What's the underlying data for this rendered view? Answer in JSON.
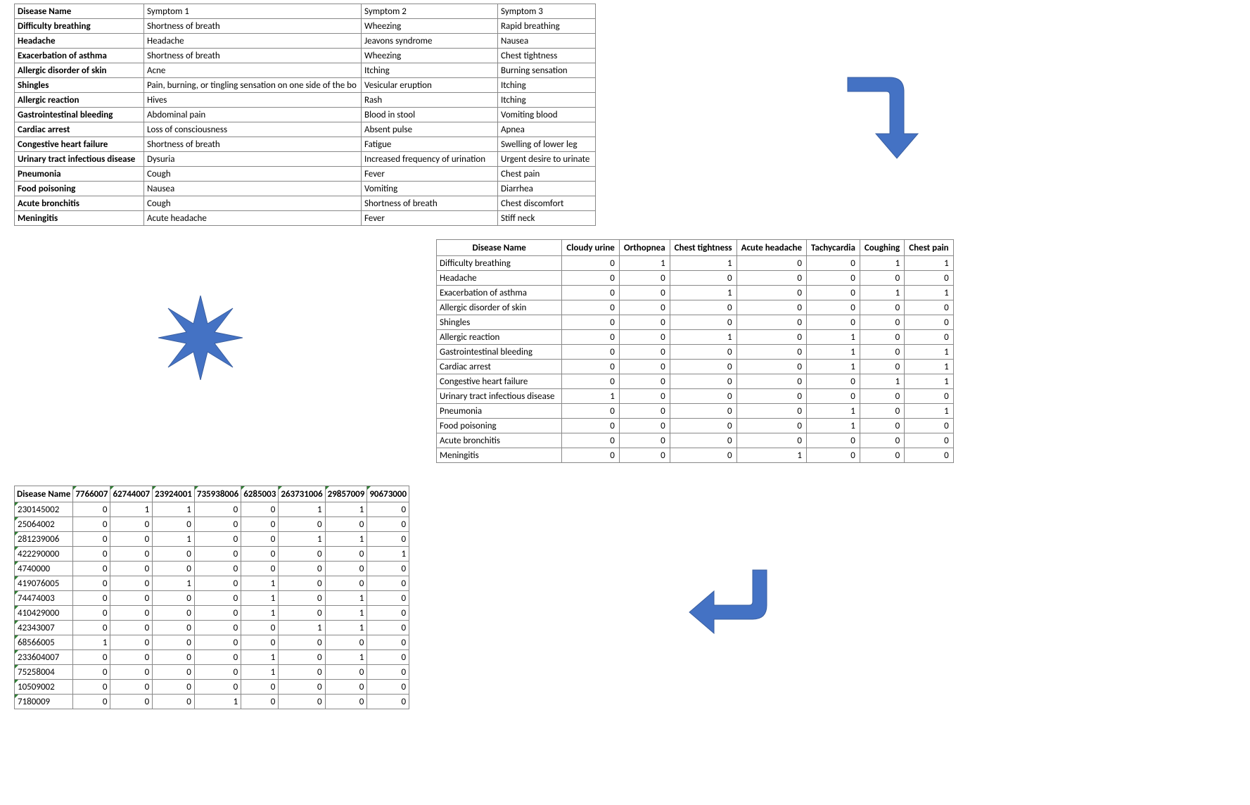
{
  "table1": {
    "headers": [
      "Disease Name",
      "Symptom 1",
      "Symptom 2",
      "Symptom 3"
    ],
    "rows": [
      [
        "Difficulty breathing",
        "Shortness of breath",
        "Wheezing",
        "Rapid breathing"
      ],
      [
        "Headache",
        "Headache",
        " Jeavons syndrome",
        "Nausea"
      ],
      [
        "Exacerbation of asthma",
        "Shortness of breath",
        "Wheezing",
        "Chest tightness"
      ],
      [
        "Allergic disorder of skin",
        "Acne",
        "Itching",
        "Burning sensation"
      ],
      [
        "Shingles",
        "Pain, burning, or tingling sensation on one side of the bo",
        "Vesicular eruption",
        "Itching"
      ],
      [
        "Allergic reaction",
        "Hives",
        "Rash",
        "Itching"
      ],
      [
        "Gastrointestinal bleeding",
        "Abdominal pain",
        "Blood in stool",
        "Vomiting blood"
      ],
      [
        "Cardiac arrest",
        "Loss of consciousness",
        " Absent pulse",
        "Apnea"
      ],
      [
        "Congestive heart failure",
        "Shortness of breath",
        "Fatigue",
        "Swelling of lower leg"
      ],
      [
        "Urinary tract infectious disease",
        "Dysuria",
        " Increased frequency of urination",
        "Urgent desire to urinate"
      ],
      [
        "Pneumonia",
        "Cough",
        "Fever",
        "Chest pain"
      ],
      [
        "Food poisoning",
        "Nausea",
        "Vomiting",
        "Diarrhea"
      ],
      [
        "Acute bronchitis",
        "Cough",
        "Shortness of breath",
        "Chest discomfort"
      ],
      [
        "Meningitis",
        "Acute headache",
        "Fever",
        "Stiff neck"
      ]
    ]
  },
  "table2": {
    "headers": [
      "Disease Name",
      "Cloudy urine",
      "Orthopnea",
      "Chest tightness",
      "Acute headache",
      "Tachycardia",
      "Coughing",
      "Chest pain"
    ],
    "rows": [
      [
        "Difficulty breathing",
        0,
        1,
        1,
        0,
        0,
        1,
        1
      ],
      [
        "Headache",
        0,
        0,
        0,
        0,
        0,
        0,
        0
      ],
      [
        "Exacerbation of asthma",
        0,
        0,
        1,
        0,
        0,
        1,
        1
      ],
      [
        "Allergic disorder of skin",
        0,
        0,
        0,
        0,
        0,
        0,
        0
      ],
      [
        "Shingles",
        0,
        0,
        0,
        0,
        0,
        0,
        0
      ],
      [
        "Allergic reaction",
        0,
        0,
        1,
        0,
        1,
        0,
        0
      ],
      [
        "Gastrointestinal bleeding",
        0,
        0,
        0,
        0,
        1,
        0,
        1
      ],
      [
        "Cardiac arrest",
        0,
        0,
        0,
        0,
        1,
        0,
        1
      ],
      [
        "Congestive heart failure",
        0,
        0,
        0,
        0,
        0,
        1,
        1
      ],
      [
        "Urinary tract infectious disease",
        1,
        0,
        0,
        0,
        0,
        0,
        0
      ],
      [
        "Pneumonia",
        0,
        0,
        0,
        0,
        1,
        0,
        1
      ],
      [
        "Food poisoning",
        0,
        0,
        0,
        0,
        1,
        0,
        0
      ],
      [
        "Acute bronchitis",
        0,
        0,
        0,
        0,
        0,
        0,
        0
      ],
      [
        "Meningitis",
        0,
        0,
        0,
        1,
        0,
        0,
        0
      ]
    ]
  },
  "table3": {
    "headers": [
      "Disease Name",
      "7766007",
      "62744007",
      "23924001",
      "735938006",
      "6285003",
      "263731006",
      "29857009",
      "90673000"
    ],
    "rows": [
      [
        "230145002",
        0,
        1,
        1,
        0,
        0,
        1,
        1,
        0
      ],
      [
        "25064002",
        0,
        0,
        0,
        0,
        0,
        0,
        0,
        0
      ],
      [
        "281239006",
        0,
        0,
        1,
        0,
        0,
        1,
        1,
        0
      ],
      [
        "422290000",
        0,
        0,
        0,
        0,
        0,
        0,
        0,
        1
      ],
      [
        "4740000",
        0,
        0,
        0,
        0,
        0,
        0,
        0,
        0
      ],
      [
        "419076005",
        0,
        0,
        1,
        0,
        1,
        0,
        0,
        0
      ],
      [
        "74474003",
        0,
        0,
        0,
        0,
        1,
        0,
        1,
        0
      ],
      [
        "410429000",
        0,
        0,
        0,
        0,
        1,
        0,
        1,
        0
      ],
      [
        "42343007",
        0,
        0,
        0,
        0,
        0,
        1,
        1,
        0
      ],
      [
        "68566005",
        1,
        0,
        0,
        0,
        0,
        0,
        0,
        0
      ],
      [
        "233604007",
        0,
        0,
        0,
        0,
        1,
        0,
        1,
        0
      ],
      [
        "75258004",
        0,
        0,
        0,
        0,
        1,
        0,
        0,
        0
      ],
      [
        "10509002",
        0,
        0,
        0,
        0,
        0,
        0,
        0,
        0
      ],
      [
        "7180009",
        0,
        0,
        0,
        1,
        0,
        0,
        0,
        0
      ]
    ]
  },
  "shapes": {
    "arrow_color": "#4472C4",
    "star_color": "#4472C4"
  }
}
